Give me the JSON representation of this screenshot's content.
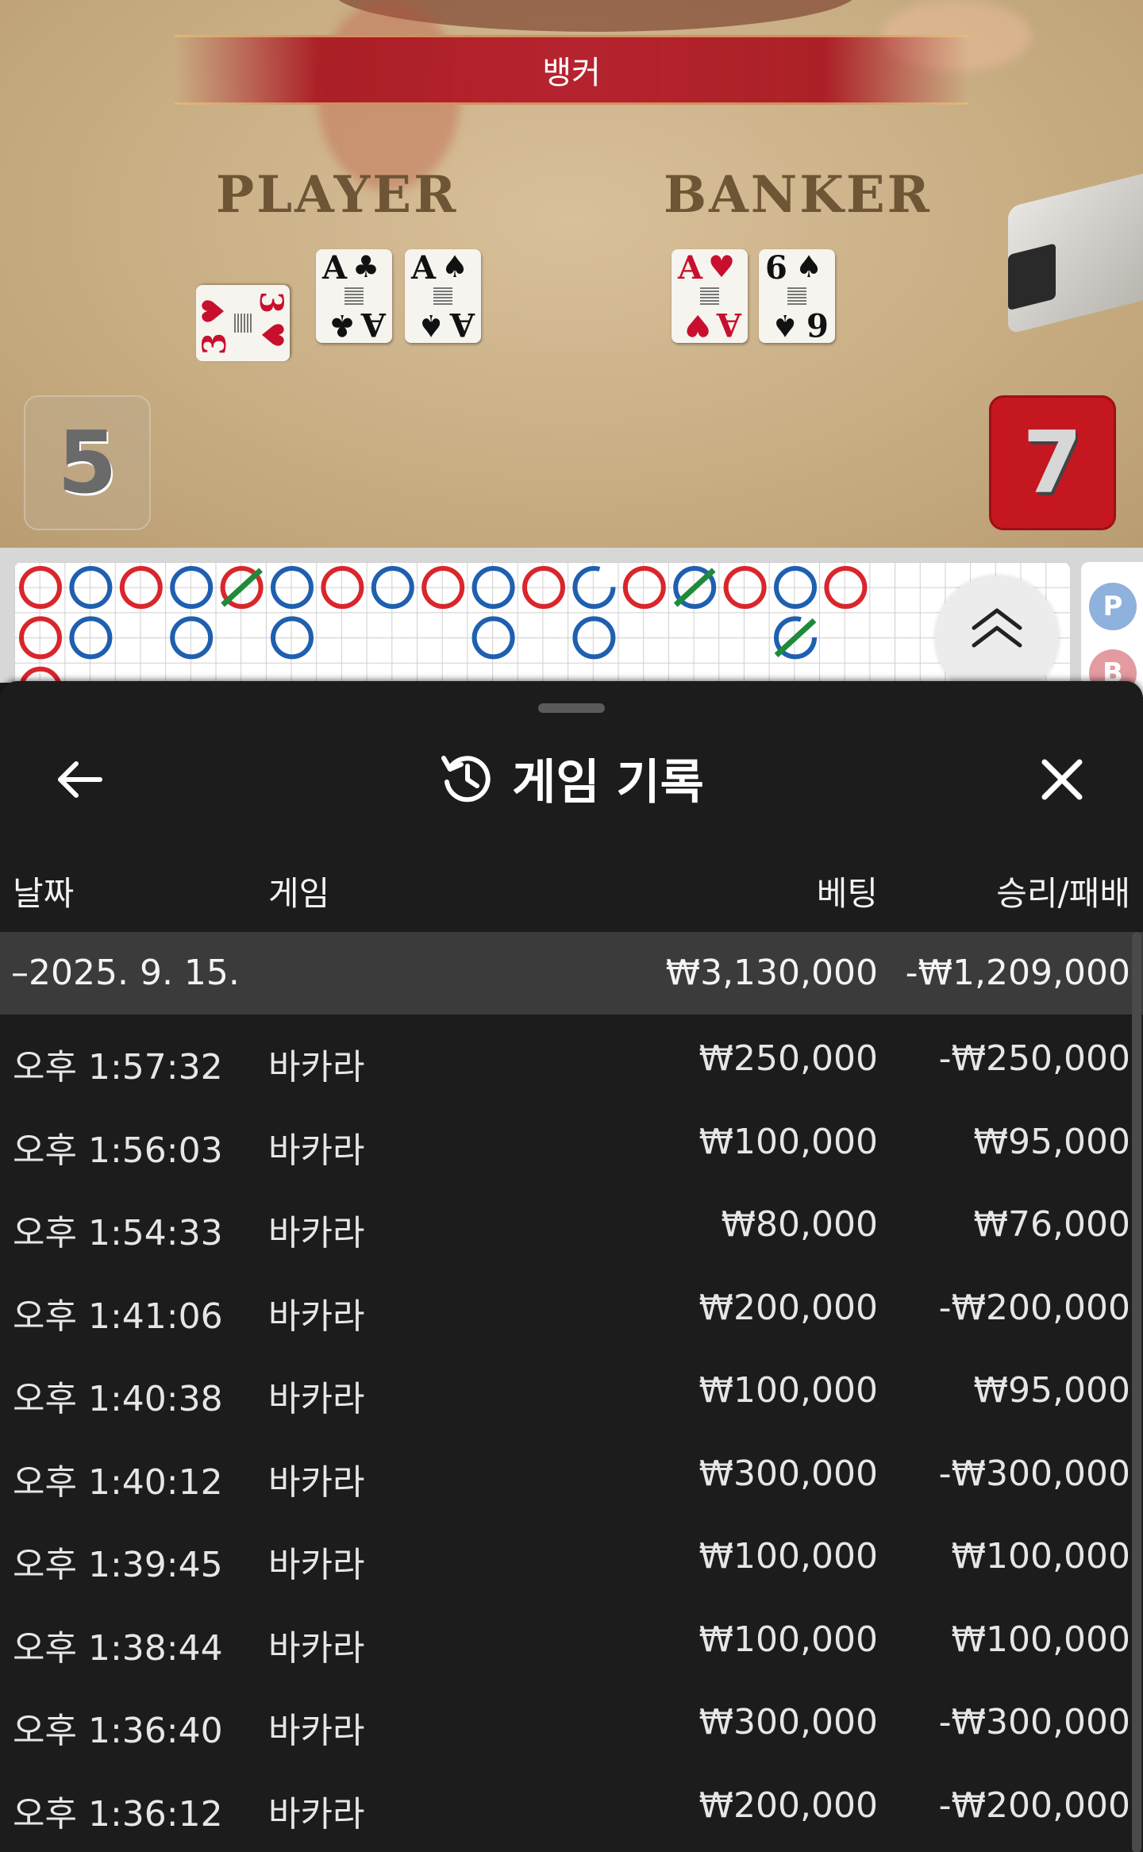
{
  "table": {
    "result_banner": "뱅커",
    "player_label": "PLAYER",
    "banker_label": "BANKER",
    "player_score": "5",
    "banker_score": "7",
    "player_cards": [
      {
        "rank": "3",
        "suit": "♥",
        "color": "red"
      },
      {
        "rank": "A",
        "suit": "♣",
        "color": "black"
      },
      {
        "rank": "A",
        "suit": "♠",
        "color": "black"
      }
    ],
    "banker_cards": [
      {
        "rank": "A",
        "suit": "♥",
        "color": "red"
      },
      {
        "rank": "6",
        "suit": "♠",
        "color": "black"
      }
    ]
  },
  "roadmap": {
    "colors": {
      "banker": "#d9262c",
      "player": "#1f5fb0",
      "tie": "#1e8a3a"
    },
    "side_labels": [
      "P",
      "B"
    ],
    "beads": [
      [
        "B",
        "B",
        "B"
      ],
      [
        "P",
        "P"
      ],
      [
        "B"
      ],
      [
        "P",
        "P"
      ],
      [
        "BT"
      ],
      [
        "P",
        "P"
      ],
      [
        "B"
      ],
      [
        "P"
      ],
      [
        "B"
      ],
      [
        "P",
        "P"
      ],
      [
        "B"
      ],
      [
        "Pd",
        "P"
      ],
      [
        "B"
      ],
      [
        "PT"
      ],
      [
        "B"
      ],
      [
        "P",
        "PdT"
      ],
      [
        "B"
      ]
    ]
  },
  "sheet": {
    "title": "게임 기록",
    "icons": {
      "back": "back-arrow-icon",
      "history": "history-icon",
      "close": "close-icon",
      "expand": "chevron-up-double-icon"
    },
    "columns": {
      "date": "날짜",
      "game": "게임",
      "bet": "베팅",
      "result": "승리/패배"
    },
    "day": {
      "date": "–2025. 9. 15.",
      "bet": "₩3,130,000",
      "result": "-₩1,209,000"
    },
    "rows": [
      {
        "time": "오후 1:57:32",
        "game": "바카라",
        "bet": "₩250,000",
        "result": "-₩250,000"
      },
      {
        "time": "오후 1:56:03",
        "game": "바카라",
        "bet": "₩100,000",
        "result": "₩95,000"
      },
      {
        "time": "오후 1:54:33",
        "game": "바카라",
        "bet": "₩80,000",
        "result": "₩76,000"
      },
      {
        "time": "오후 1:41:06",
        "game": "바카라",
        "bet": "₩200,000",
        "result": "-₩200,000"
      },
      {
        "time": "오후 1:40:38",
        "game": "바카라",
        "bet": "₩100,000",
        "result": "₩95,000"
      },
      {
        "time": "오후 1:40:12",
        "game": "바카라",
        "bet": "₩300,000",
        "result": "-₩300,000"
      },
      {
        "time": "오후 1:39:45",
        "game": "바카라",
        "bet": "₩100,000",
        "result": "₩100,000"
      },
      {
        "time": "오후 1:38:44",
        "game": "바카라",
        "bet": "₩100,000",
        "result": "₩100,000"
      },
      {
        "time": "오후 1:36:40",
        "game": "바카라",
        "bet": "₩300,000",
        "result": "-₩300,000"
      },
      {
        "time": "오후 1:36:12",
        "game": "바카라",
        "bet": "₩200,000",
        "result": "-₩200,000"
      }
    ]
  }
}
